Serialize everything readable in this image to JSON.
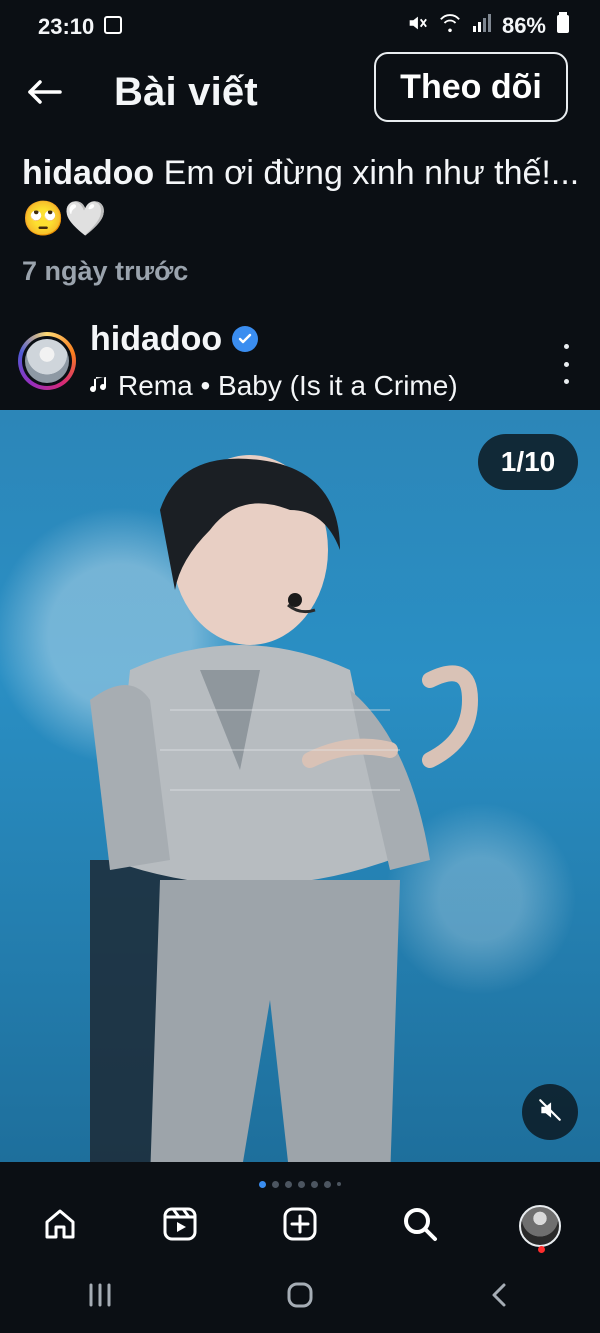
{
  "status_bar": {
    "time": "23:10",
    "battery": "86%"
  },
  "header": {
    "title": "Bài viết",
    "follow_label": "Theo dõi"
  },
  "post": {
    "caption_username": "hidadoo",
    "caption_text": " Em ơi đừng xinh như thế!...🙄🤍",
    "time_ago": "7 ngày trước",
    "author_username": "hidadoo",
    "music": "Rema • Baby (Is it a Crime)",
    "media_counter": "1/10"
  },
  "colors": {
    "background": "#0b0f14",
    "accent": "#3a8df0",
    "muted_text": "#9aa3ad",
    "notification": "#ff2d2d"
  },
  "icons": {
    "back": "back-arrow-icon",
    "more": "more-vertical-icon",
    "mute": "muted-speaker-icon",
    "home": "home-icon",
    "reels": "reels-icon",
    "create": "create-plus-icon",
    "search": "search-icon",
    "recents": "recents-icon",
    "home_system": "home-circle-icon",
    "back_system": "chevron-left-icon"
  }
}
